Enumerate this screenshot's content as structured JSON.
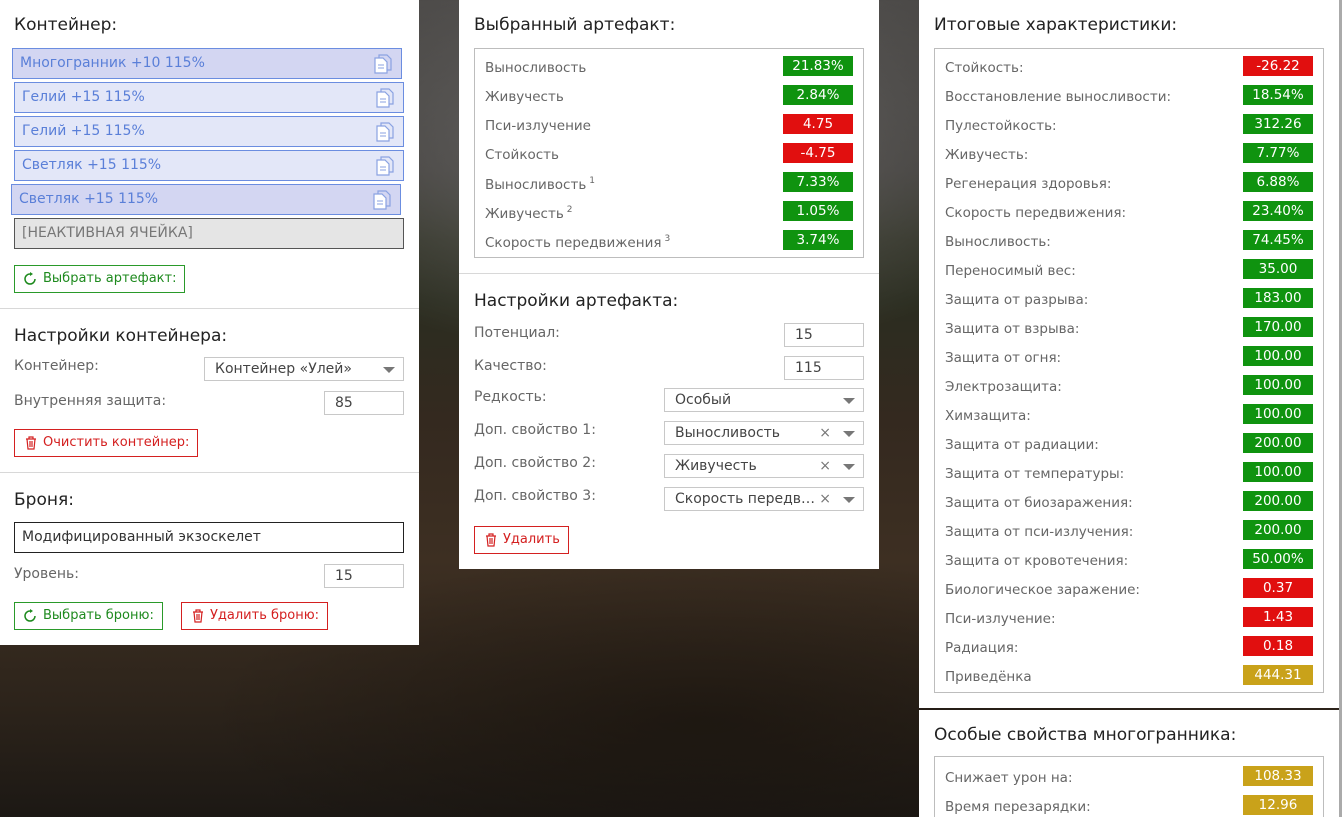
{
  "left": {
    "container_title": "Контейнер:",
    "slots": [
      {
        "label": "Многогранник +10 115%",
        "selected": true
      },
      {
        "label": "Гелий +15 115%",
        "selected": false
      },
      {
        "label": "Гелий +15 115%",
        "selected": false
      },
      {
        "label": "Светляк +15 115%",
        "selected": false
      },
      {
        "label": "Светляк +15 115%",
        "selected": true
      },
      {
        "label": "[НЕАКТИВНАЯ ЯЧЕЙКА]",
        "inactive": true
      }
    ],
    "choose_artifact_label": "Выбрать артефакт:",
    "container_settings_title": "Настройки контейнера:",
    "container_label": "Контейнер:",
    "container_value": "Контейнер «Улей»",
    "inner_protection_label": "Внутренняя защита:",
    "inner_protection_value": "85",
    "clear_container_label": "Очистить контейнер:",
    "armor_title": "Броня:",
    "armor_value": "Модифицированный экзоскелет",
    "level_label": "Уровень:",
    "level_value": "15",
    "choose_armor_label": "Выбрать броню:",
    "delete_armor_label": "Удалить броню:"
  },
  "mid": {
    "selected_title": "Выбранный артефакт:",
    "stats": [
      {
        "name": "Выносливость",
        "sup": "",
        "value": "21.83%",
        "color": "g"
      },
      {
        "name": "Живучесть",
        "sup": "",
        "value": "2.84%",
        "color": "g"
      },
      {
        "name": "Пси-излучение",
        "sup": "",
        "value": "4.75",
        "color": "r"
      },
      {
        "name": "Стойкость",
        "sup": "",
        "value": "-4.75",
        "color": "r"
      },
      {
        "name": "Выносливость",
        "sup": "1",
        "value": "7.33%",
        "color": "g"
      },
      {
        "name": "Живучесть",
        "sup": "2",
        "value": "1.05%",
        "color": "g"
      },
      {
        "name": "Скорость передвижения",
        "sup": "3",
        "value": "3.74%",
        "color": "g"
      }
    ],
    "settings_title": "Настройки артефакта:",
    "potential_label": "Потенциал:",
    "potential_value": "15",
    "quality_label": "Качество:",
    "quality_value": "115",
    "rarity_label": "Редкость:",
    "rarity_value": "Особый",
    "prop1_label": "Доп. свойство 1:",
    "prop1_value": "Выносливость",
    "prop2_label": "Доп. свойство 2:",
    "prop2_value": "Живучесть",
    "prop3_label": "Доп. свойство 3:",
    "prop3_value": "Скорость передвижения",
    "clear_symbol": "×",
    "delete_label": "Удалить"
  },
  "right": {
    "totals_title": "Итоговые характеристики:",
    "stats": [
      {
        "name": "Стойкость:",
        "value": "-26.22",
        "color": "r"
      },
      {
        "name": "Восстановление выносливости:",
        "value": "18.54%",
        "color": "g"
      },
      {
        "name": "Пулестойкость:",
        "value": "312.26",
        "color": "g"
      },
      {
        "name": "Живучесть:",
        "value": "7.77%",
        "color": "g"
      },
      {
        "name": "Регенерация здоровья:",
        "value": "6.88%",
        "color": "g"
      },
      {
        "name": "Скорость передвижения:",
        "value": "23.40%",
        "color": "g"
      },
      {
        "name": "Выносливость:",
        "value": "74.45%",
        "color": "g"
      },
      {
        "name": "Переносимый вес:",
        "value": "35.00",
        "color": "g"
      },
      {
        "name": "Защита от разрыва:",
        "value": "183.00",
        "color": "g"
      },
      {
        "name": "Защита от взрыва:",
        "value": "170.00",
        "color": "g"
      },
      {
        "name": "Защита от огня:",
        "value": "100.00",
        "color": "g"
      },
      {
        "name": "Электрозащита:",
        "value": "100.00",
        "color": "g"
      },
      {
        "name": "Химзащита:",
        "value": "100.00",
        "color": "g"
      },
      {
        "name": "Защита от радиации:",
        "value": "200.00",
        "color": "g"
      },
      {
        "name": "Защита от температуры:",
        "value": "100.00",
        "color": "g"
      },
      {
        "name": "Защита от биозаражения:",
        "value": "200.00",
        "color": "g"
      },
      {
        "name": "Защита от пси-излучения:",
        "value": "200.00",
        "color": "g"
      },
      {
        "name": "Защита от кровотечения:",
        "value": "50.00%",
        "color": "g"
      },
      {
        "name": "Биологическое заражение:",
        "value": "0.37",
        "color": "r"
      },
      {
        "name": "Пси-излучение:",
        "value": "1.43",
        "color": "r"
      },
      {
        "name": "Радиация:",
        "value": "0.18",
        "color": "r"
      },
      {
        "name": "Приведёнка",
        "value": "444.31",
        "color": "y"
      }
    ],
    "special_title": "Особые свойства многогранника:",
    "special": [
      {
        "name": "Снижает урон на:",
        "value": "108.33",
        "color": "y"
      },
      {
        "name": "Время перезарядки:",
        "value": "12.96",
        "color": "y"
      }
    ]
  }
}
